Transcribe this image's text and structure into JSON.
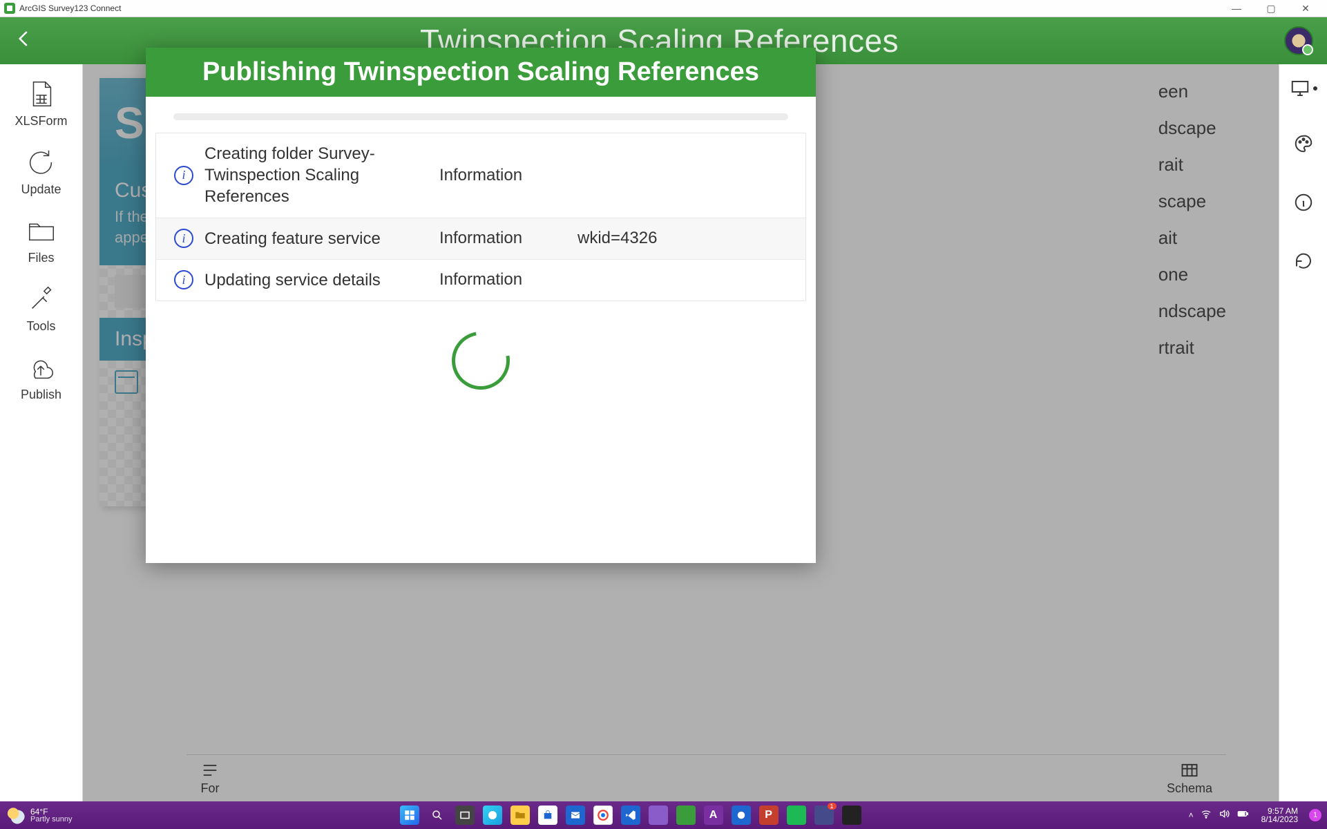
{
  "window": {
    "title": "ArcGIS Survey123 Connect"
  },
  "header": {
    "survey_title": "Twinspection Scaling References"
  },
  "left_rail": {
    "items": [
      {
        "label": "XLSForm"
      },
      {
        "label": "Update"
      },
      {
        "label": "Files"
      },
      {
        "label": "Tools"
      },
      {
        "label": "Publish"
      }
    ]
  },
  "form_preview": {
    "title_fragment": "Si",
    "section1_label": "Cus",
    "section1_hint_line1": "If the",
    "section1_hint_line2": "appe",
    "section2_label": "Insp"
  },
  "right_options": {
    "items": [
      "een",
      "dscape",
      "rait",
      "scape",
      "ait",
      "one",
      "ndscape",
      "rtrait"
    ]
  },
  "bottom_tabs": {
    "left_label": "For",
    "right_label": "Schema"
  },
  "dialog": {
    "title": "Publishing Twinspection Scaling References",
    "rows": [
      {
        "message": "Creating folder Survey-Twinspection Scaling References",
        "level": "Information",
        "detail": ""
      },
      {
        "message": "Creating feature service",
        "level": "Information",
        "detail": "wkid=4326"
      },
      {
        "message": "Updating service details",
        "level": "Information",
        "detail": ""
      }
    ]
  },
  "taskbar": {
    "temperature": "64°F",
    "condition": "Partly sunny",
    "time": "9:57 AM",
    "date": "8/14/2023"
  }
}
